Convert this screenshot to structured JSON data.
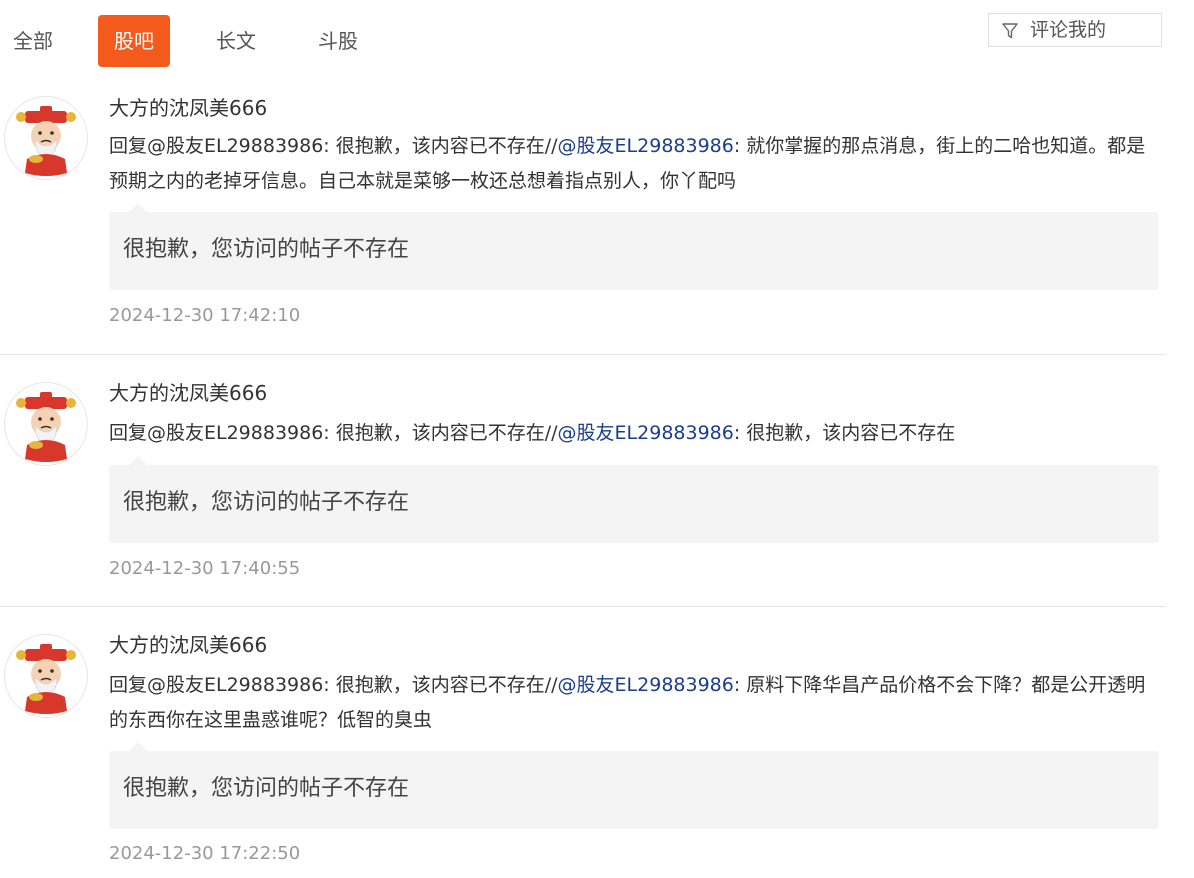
{
  "tabs": [
    {
      "label": "全部",
      "active": false
    },
    {
      "label": "股吧",
      "active": true
    },
    {
      "label": "长文",
      "active": false
    },
    {
      "label": "斗股",
      "active": false
    }
  ],
  "filter": {
    "label": "评论我的",
    "icon": "funnel-icon"
  },
  "colors": {
    "accent": "#f35a1b",
    "mention": "#1a3e8c",
    "quote_bg": "#f4f4f4",
    "timestamp": "#999999"
  },
  "comments": [
    {
      "user": "大方的沈凤美666",
      "avatar_icon": "caishen-avatar-icon",
      "reply_prefix": "回复@股友EL29883986: 很抱歉，该内容已不存在//",
      "mention": "@股友EL29883986",
      "reply_rest": ": 就你掌握的那点消息，街上的二哈也知道。都是预期之内的老掉牙信息。自己本就是菜够一枚还总想着指点别人，你丫配吗",
      "quote": "很抱歉，您访问的帖子不存在",
      "time": "2024-12-30 17:42:10"
    },
    {
      "user": "大方的沈凤美666",
      "avatar_icon": "caishen-avatar-icon",
      "reply_prefix": "回复@股友EL29883986: 很抱歉，该内容已不存在//",
      "mention": "@股友EL29883986",
      "reply_rest": ": 很抱歉，该内容已不存在",
      "quote": "很抱歉，您访问的帖子不存在",
      "time": "2024-12-30 17:40:55"
    },
    {
      "user": "大方的沈凤美666",
      "avatar_icon": "caishen-avatar-icon",
      "reply_prefix": "回复@股友EL29883986: 很抱歉，该内容已不存在//",
      "mention": "@股友EL29883986",
      "reply_rest": ": 原料下降华昌产品价格不会下降？都是公开透明的东西你在这里蛊惑谁呢？低智的臭虫",
      "quote": "很抱歉，您访问的帖子不存在",
      "time": "2024-12-30 17:22:50"
    }
  ]
}
